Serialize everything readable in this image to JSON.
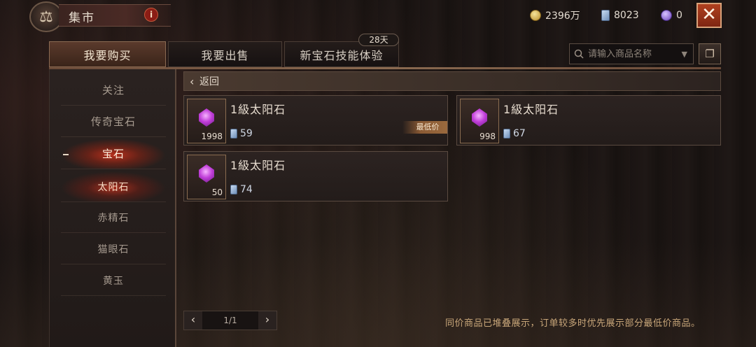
{
  "header": {
    "title": "集市",
    "info_label": "i",
    "close_label": "✕",
    "emblem_glyph": "⚖"
  },
  "currencies": {
    "gold": "2396万",
    "diamond": "8023",
    "purple": "0"
  },
  "tabs": [
    {
      "label": "我要购买",
      "active": true
    },
    {
      "label": "我要出售",
      "active": false
    },
    {
      "label": "新宝石技能体验",
      "active": false,
      "badge": "28天"
    }
  ],
  "search": {
    "placeholder": "请输入商品名称",
    "dropdown_glyph": "▼",
    "filter_glyph": "❐"
  },
  "sidebar": {
    "items": [
      {
        "label": "关注"
      },
      {
        "label": "传奇宝石"
      },
      {
        "label": "宝石",
        "active": true
      },
      {
        "label": "太阳石",
        "active": true,
        "sub": true
      },
      {
        "label": "赤精石",
        "sub": true
      },
      {
        "label": "猫眼石",
        "sub": true
      },
      {
        "label": "黄玉",
        "sub": true
      }
    ]
  },
  "back": {
    "label": "返回"
  },
  "listings": [
    {
      "name": "1級太阳石",
      "quantity": "1998",
      "price": "59",
      "tag": "最低价"
    },
    {
      "name": "1級太阳石",
      "quantity": "998",
      "price": "67"
    },
    {
      "name": "1級太阳石",
      "quantity": "50",
      "price": "74"
    }
  ],
  "pager": {
    "prev": "‹",
    "next": "›",
    "page": "1/1"
  },
  "notice": "同价商品已堆叠展示，订单较多时优先展示部分最低价商品。",
  "colors": {
    "accent_red": "#b8301c",
    "gold_text": "#c9a77a",
    "close_button": "#b0401f"
  }
}
